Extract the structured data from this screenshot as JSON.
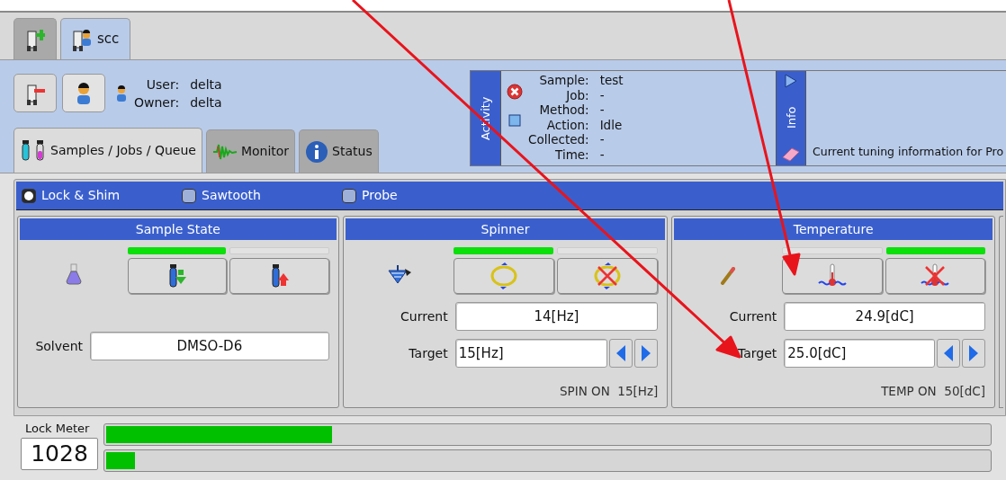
{
  "top_tabs": [
    {
      "kind": "add",
      "selected": false
    },
    {
      "kind": "user",
      "label": "scc",
      "selected": true
    }
  ],
  "session": {
    "user_label": "User:",
    "user": "delta",
    "owner_label": "Owner:",
    "owner": "delta"
  },
  "view_tabs": [
    {
      "kind": "samples",
      "label": "Samples / Jobs / Queue",
      "selected": true
    },
    {
      "kind": "monitor",
      "label": "Monitor",
      "selected": false
    },
    {
      "kind": "status",
      "label": "Status",
      "selected": false
    }
  ],
  "activity": {
    "title": "Activity",
    "fields": [
      {
        "label": "Sample:",
        "value": "test"
      },
      {
        "label": "Job:",
        "value": "-"
      },
      {
        "label": "Method:",
        "value": "-"
      },
      {
        "label": "Action:",
        "value": "Idle"
      },
      {
        "label": "Collected:",
        "value": "-"
      },
      {
        "label": "Time:",
        "value": "-"
      }
    ]
  },
  "info": {
    "title": "Info",
    "text": "Current tuning information for Pro"
  },
  "modes": [
    {
      "label": "Lock & Shim",
      "selected": true
    },
    {
      "label": "Sawtooth",
      "selected": false
    },
    {
      "label": "Probe",
      "selected": false
    }
  ],
  "panels": [
    {
      "kind": "sample",
      "title": "Sample State",
      "indicators": [
        {
          "on": true
        },
        {
          "on": false
        }
      ],
      "rows": [
        {
          "label": "Solvent",
          "value": "DMSO-D6",
          "kind": "plain"
        }
      ]
    },
    {
      "kind": "spinner",
      "title": "Spinner",
      "indicators": [
        {
          "on": true
        },
        {
          "on": false
        }
      ],
      "rows": [
        {
          "label": "Current",
          "value": "14[Hz]",
          "kind": "plain"
        },
        {
          "label": "Target",
          "value": "15[Hz]",
          "kind": "spin"
        }
      ],
      "status": "SPIN ON  15[Hz]"
    },
    {
      "kind": "temperature",
      "title": "Temperature",
      "indicators": [
        {
          "on": false
        },
        {
          "on": true
        }
      ],
      "rows": [
        {
          "label": "Current",
          "value": "24.9[dC]",
          "kind": "plain"
        },
        {
          "label": "Target",
          "value": "25.0[dC]",
          "kind": "spin"
        }
      ],
      "status": "TEMP ON  50[dC]"
    }
  ],
  "lock_meter": {
    "label": "Lock Meter",
    "value": "1028",
    "bars": [
      {
        "level": 0.256
      },
      {
        "level": 0.033
      }
    ]
  }
}
